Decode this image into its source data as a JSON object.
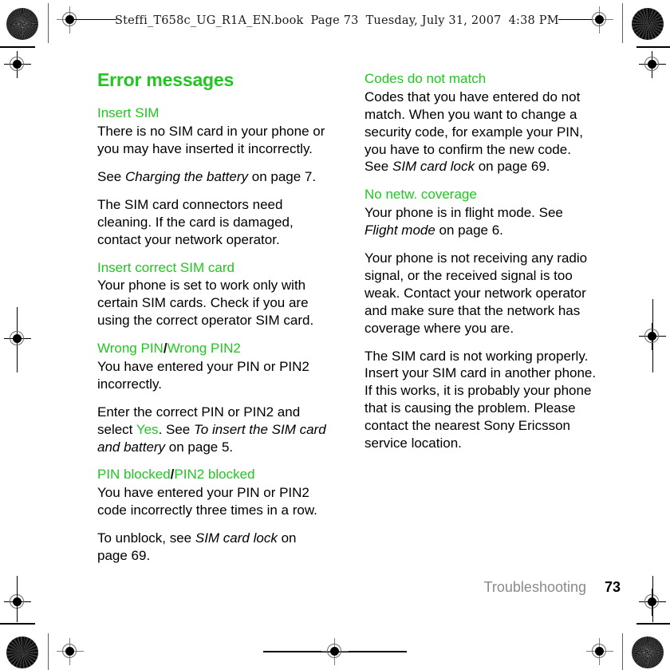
{
  "print_slug": {
    "filename": "Steffi_T658c_UG_R1A_EN.book",
    "page_label": "Page 73",
    "date": "Tuesday, July 31, 2007",
    "time": "4:38 PM"
  },
  "accent_color": "#22c522",
  "gray_color": "#8a8a8a",
  "columns": {
    "left": {
      "title": "Error messages",
      "blocks": [
        {
          "heading": "Insert SIM",
          "paragraphs": [
            "There is no SIM card in your phone or you may have inserted it incorrectly.",
            "See Charging the battery on page 7.",
            "The SIM card connectors need cleaning. If the card is damaged, contact your network operator."
          ]
        },
        {
          "heading": "Insert correct SIM card",
          "paragraphs": [
            "Your phone is set to work only with certain SIM cards. Check if you are using the correct operator SIM card."
          ]
        },
        {
          "heading_a": "Wrong PIN",
          "heading_sep": "/",
          "heading_b": "Wrong PIN2",
          "paragraphs": [
            "You have entered your PIN or PIN2 incorrectly.",
            "Enter the correct PIN or PIN2 and select Yes. See To insert the SIM card and battery on page 5."
          ]
        },
        {
          "heading_a": "PIN blocked",
          "heading_sep": "/",
          "heading_b": "PIN2 blocked",
          "paragraphs": [
            "You have entered your PIN or PIN2 code incorrectly three times in a row.",
            "To unblock, see SIM card lock on page 69."
          ]
        }
      ]
    },
    "right": {
      "blocks": [
        {
          "heading": "Codes do not match",
          "paragraphs": [
            "Codes that you have entered do not match. When you want to change a security code, for example your PIN, you have to confirm the new code. See SIM card lock on page 69."
          ]
        },
        {
          "heading": "No netw. coverage",
          "paragraphs": [
            "Your phone is in flight mode. See Flight mode on page 6.",
            "Your phone is not receiving any radio signal, or the received signal is too weak. Contact your network operator and make sure that the network has coverage where you are.",
            "The SIM card is not working properly. Insert your SIM card in another phone. If this works, it is probably your phone that is causing the problem. Please contact the nearest Sony Ericsson service location."
          ]
        }
      ]
    }
  },
  "footer": {
    "chapter": "Troubleshooting",
    "page_number": "73"
  },
  "fragments": {
    "l1_p2_pre": "See ",
    "l1_p2_italic": "Charging the battery",
    "l1_p2_post": " on page 7.",
    "l3_p2_pre": "Enter the correct PIN or PIN2 and select ",
    "l3_p2_green": "Yes",
    "l3_p2_mid": ". See ",
    "l3_p2_italic": "To insert the SIM card and battery",
    "l3_p2_post": " on page 5.",
    "l4_p2_pre": "To unblock, see ",
    "l4_p2_italic": "SIM card lock",
    "l4_p2_post": " on page 69.",
    "r1_p1_pre": "Codes that you have entered do not match. When you want to change a security code, for example your PIN, you have to confirm the new code. See ",
    "r1_p1_italic": "SIM card lock",
    "r1_p1_post": " on page 69.",
    "r2_p1_pre": "Your phone is in flight mode. See ",
    "r2_p1_italic": "Flight mode",
    "r2_p1_post": " on page 6."
  }
}
